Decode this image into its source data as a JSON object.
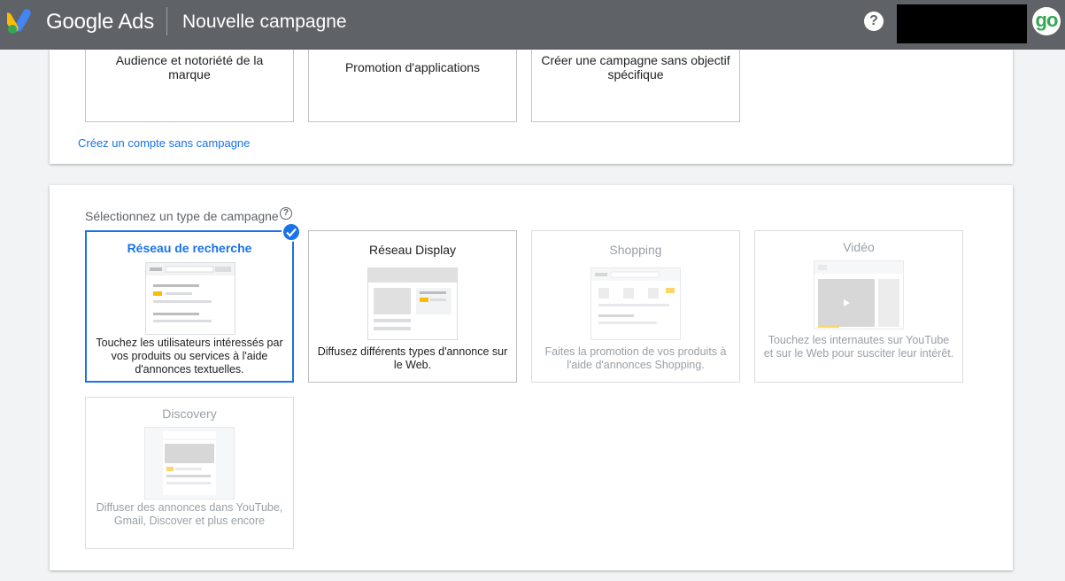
{
  "header": {
    "brand": "Google Ads",
    "page_title": "Nouvelle campagne",
    "help_label": "?",
    "avatar_text": "go"
  },
  "goals": [
    {
      "label": "Audience et notoriété de la marque"
    },
    {
      "label": "Promotion d'applications"
    },
    {
      "label": "Créer une campagne sans objectif spécifique"
    }
  ],
  "no_campaign_link": "Créez un compte sans campagne",
  "campaign_type": {
    "label": "Sélectionnez un type de campagne",
    "cards": [
      {
        "title": "Réseau de recherche",
        "desc": "Touchez les utilisateurs intéressés par vos produits ou services à l'aide d'annonces textuelles.",
        "state": "selected"
      },
      {
        "title": "Réseau Display",
        "desc": "Diffusez différents types d'annonce sur le Web.",
        "state": "enabled"
      },
      {
        "title": "Shopping",
        "desc": "Faites la promotion de vos produits à l'aide d'annonces Shopping.",
        "state": "disabled"
      },
      {
        "title": "Vidéo",
        "desc": "Touchez les internautes sur YouTube et sur le Web pour susciter leur intérêt.",
        "state": "disabled"
      },
      {
        "title": "Discovery",
        "desc": "Diffuser des annonces dans YouTube, Gmail, Discover et plus encore",
        "state": "disabled"
      }
    ]
  },
  "colors": {
    "header_bg": "#5f6368",
    "accent": "#1a73e8",
    "ads_yellow": "#fbbc04",
    "ads_green": "#34a853"
  },
  "icons": [
    "google-ads-logo",
    "help-icon",
    "question-circle-icon",
    "check-circle-icon",
    "play-icon"
  ]
}
